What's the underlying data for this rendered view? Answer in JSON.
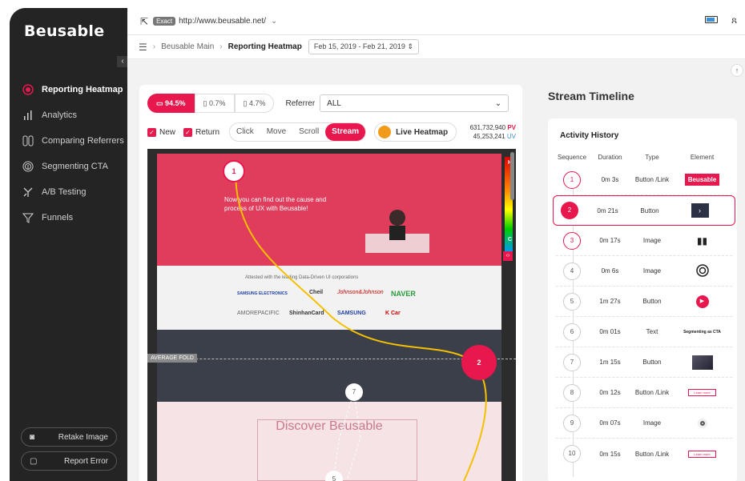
{
  "app": {
    "logo": "Beusable"
  },
  "topbar": {
    "exact_badge": "Exact",
    "url": "http://www.beusable.net/"
  },
  "breadcrumb": {
    "home": "Beusable Main",
    "current": "Reporting Heatmap",
    "date_range": "Feb 15, 2019 - Feb 21, 2019"
  },
  "sidebar": {
    "items": [
      {
        "label": "Reporting Heatmap",
        "icon": "target-icon",
        "active": true
      },
      {
        "label": "Analytics",
        "icon": "bar-chart-icon"
      },
      {
        "label": "Comparing Referrers",
        "icon": "compare-icon"
      },
      {
        "label": "Segmenting CTA",
        "icon": "fingerprint-icon"
      },
      {
        "label": "A/B Testing",
        "icon": "ab-test-icon"
      },
      {
        "label": "Funnels",
        "icon": "funnel-icon"
      }
    ],
    "retake": "Retake Image",
    "report": "Report Error"
  },
  "devices": {
    "desktop": "94.5%",
    "tablet": "0.7%",
    "mobile": "4.7%"
  },
  "referrer": {
    "label": "Referrer",
    "value": "ALL"
  },
  "filters": {
    "new": "New",
    "return": "Return"
  },
  "modes": [
    "Click",
    "Move",
    "Scroll",
    "Stream"
  ],
  "live_heatmap": "Live Heatmap",
  "stats": {
    "pv": "631,732,940",
    "pv_label": "PV",
    "uv": "45,253,241",
    "uv_label": "UV"
  },
  "heatmap": {
    "hero_title": "Now you can find out the cause and process of UX with Beusable!",
    "logos_caption": "Attested with the leading Data-Driven UI corporations",
    "logos": [
      "SAMSUNG ELECTRONICS",
      "Cheil",
      "Johnson&Johnson",
      "NAVER",
      "AMOREPACIFIC",
      "ShinhanCard",
      "SAMSUNG",
      "K Car"
    ],
    "discover": "Discover Beusable",
    "fold_label": "AVERAGE FOLD",
    "scale_h": "H",
    "scale_c": "C",
    "markers": [
      "1",
      "2",
      "7",
      "5"
    ]
  },
  "timeline": {
    "title": "Stream Timeline",
    "card_title": "Activity History",
    "headers": [
      "Sequence",
      "Duration",
      "Type",
      "Element"
    ],
    "rows": [
      {
        "seq": "1",
        "duration": "0m 3s",
        "type": "Button /Link",
        "element": "Beusable"
      },
      {
        "seq": "2",
        "duration": "0m 21s",
        "type": "Button",
        "element": ""
      },
      {
        "seq": "3",
        "duration": "0m 17s",
        "type": "Image",
        "element": ""
      },
      {
        "seq": "4",
        "duration": "0m 6s",
        "type": "Image",
        "element": ""
      },
      {
        "seq": "5",
        "duration": "1m 27s",
        "type": "Button",
        "element": ""
      },
      {
        "seq": "6",
        "duration": "0m 01s",
        "type": "Text",
        "element": "Segmenting as CTA"
      },
      {
        "seq": "7",
        "duration": "1m 15s",
        "type": "Button",
        "element": ""
      },
      {
        "seq": "8",
        "duration": "0m 12s",
        "type": "Button /Link",
        "element": "Learn more"
      },
      {
        "seq": "9",
        "duration": "0m 07s",
        "type": "Image",
        "element": ""
      },
      {
        "seq": "10",
        "duration": "0m 15s",
        "type": "Button /Link",
        "element": "Learn more"
      }
    ]
  },
  "colors": {
    "accent": "#e8174d",
    "sidebar": "#242424",
    "stream_line": "#f5c000"
  }
}
